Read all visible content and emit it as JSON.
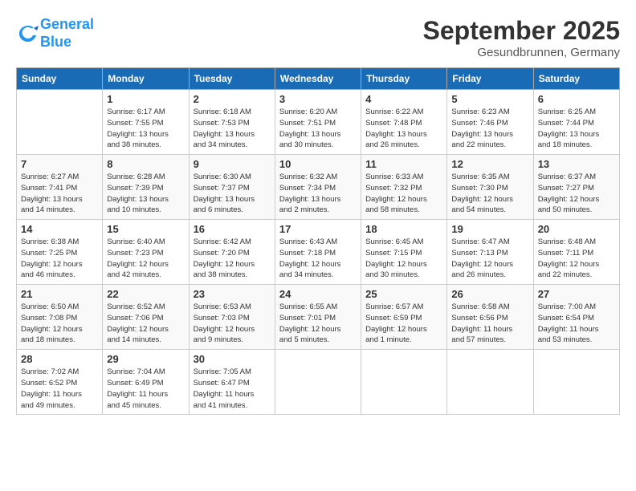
{
  "logo": {
    "line1": "General",
    "line2": "Blue"
  },
  "title": "September 2025",
  "location": "Gesundbrunnen, Germany",
  "weekdays": [
    "Sunday",
    "Monday",
    "Tuesday",
    "Wednesday",
    "Thursday",
    "Friday",
    "Saturday"
  ],
  "weeks": [
    [
      {
        "day": "",
        "info": ""
      },
      {
        "day": "1",
        "info": "Sunrise: 6:17 AM\nSunset: 7:55 PM\nDaylight: 13 hours\nand 38 minutes."
      },
      {
        "day": "2",
        "info": "Sunrise: 6:18 AM\nSunset: 7:53 PM\nDaylight: 13 hours\nand 34 minutes."
      },
      {
        "day": "3",
        "info": "Sunrise: 6:20 AM\nSunset: 7:51 PM\nDaylight: 13 hours\nand 30 minutes."
      },
      {
        "day": "4",
        "info": "Sunrise: 6:22 AM\nSunset: 7:48 PM\nDaylight: 13 hours\nand 26 minutes."
      },
      {
        "day": "5",
        "info": "Sunrise: 6:23 AM\nSunset: 7:46 PM\nDaylight: 13 hours\nand 22 minutes."
      },
      {
        "day": "6",
        "info": "Sunrise: 6:25 AM\nSunset: 7:44 PM\nDaylight: 13 hours\nand 18 minutes."
      }
    ],
    [
      {
        "day": "7",
        "info": "Sunrise: 6:27 AM\nSunset: 7:41 PM\nDaylight: 13 hours\nand 14 minutes."
      },
      {
        "day": "8",
        "info": "Sunrise: 6:28 AM\nSunset: 7:39 PM\nDaylight: 13 hours\nand 10 minutes."
      },
      {
        "day": "9",
        "info": "Sunrise: 6:30 AM\nSunset: 7:37 PM\nDaylight: 13 hours\nand 6 minutes."
      },
      {
        "day": "10",
        "info": "Sunrise: 6:32 AM\nSunset: 7:34 PM\nDaylight: 13 hours\nand 2 minutes."
      },
      {
        "day": "11",
        "info": "Sunrise: 6:33 AM\nSunset: 7:32 PM\nDaylight: 12 hours\nand 58 minutes."
      },
      {
        "day": "12",
        "info": "Sunrise: 6:35 AM\nSunset: 7:30 PM\nDaylight: 12 hours\nand 54 minutes."
      },
      {
        "day": "13",
        "info": "Sunrise: 6:37 AM\nSunset: 7:27 PM\nDaylight: 12 hours\nand 50 minutes."
      }
    ],
    [
      {
        "day": "14",
        "info": "Sunrise: 6:38 AM\nSunset: 7:25 PM\nDaylight: 12 hours\nand 46 minutes."
      },
      {
        "day": "15",
        "info": "Sunrise: 6:40 AM\nSunset: 7:23 PM\nDaylight: 12 hours\nand 42 minutes."
      },
      {
        "day": "16",
        "info": "Sunrise: 6:42 AM\nSunset: 7:20 PM\nDaylight: 12 hours\nand 38 minutes."
      },
      {
        "day": "17",
        "info": "Sunrise: 6:43 AM\nSunset: 7:18 PM\nDaylight: 12 hours\nand 34 minutes."
      },
      {
        "day": "18",
        "info": "Sunrise: 6:45 AM\nSunset: 7:15 PM\nDaylight: 12 hours\nand 30 minutes."
      },
      {
        "day": "19",
        "info": "Sunrise: 6:47 AM\nSunset: 7:13 PM\nDaylight: 12 hours\nand 26 minutes."
      },
      {
        "day": "20",
        "info": "Sunrise: 6:48 AM\nSunset: 7:11 PM\nDaylight: 12 hours\nand 22 minutes."
      }
    ],
    [
      {
        "day": "21",
        "info": "Sunrise: 6:50 AM\nSunset: 7:08 PM\nDaylight: 12 hours\nand 18 minutes."
      },
      {
        "day": "22",
        "info": "Sunrise: 6:52 AM\nSunset: 7:06 PM\nDaylight: 12 hours\nand 14 minutes."
      },
      {
        "day": "23",
        "info": "Sunrise: 6:53 AM\nSunset: 7:03 PM\nDaylight: 12 hours\nand 9 minutes."
      },
      {
        "day": "24",
        "info": "Sunrise: 6:55 AM\nSunset: 7:01 PM\nDaylight: 12 hours\nand 5 minutes."
      },
      {
        "day": "25",
        "info": "Sunrise: 6:57 AM\nSunset: 6:59 PM\nDaylight: 12 hours\nand 1 minute."
      },
      {
        "day": "26",
        "info": "Sunrise: 6:58 AM\nSunset: 6:56 PM\nDaylight: 11 hours\nand 57 minutes."
      },
      {
        "day": "27",
        "info": "Sunrise: 7:00 AM\nSunset: 6:54 PM\nDaylight: 11 hours\nand 53 minutes."
      }
    ],
    [
      {
        "day": "28",
        "info": "Sunrise: 7:02 AM\nSunset: 6:52 PM\nDaylight: 11 hours\nand 49 minutes."
      },
      {
        "day": "29",
        "info": "Sunrise: 7:04 AM\nSunset: 6:49 PM\nDaylight: 11 hours\nand 45 minutes."
      },
      {
        "day": "30",
        "info": "Sunrise: 7:05 AM\nSunset: 6:47 PM\nDaylight: 11 hours\nand 41 minutes."
      },
      {
        "day": "",
        "info": ""
      },
      {
        "day": "",
        "info": ""
      },
      {
        "day": "",
        "info": ""
      },
      {
        "day": "",
        "info": ""
      }
    ]
  ]
}
